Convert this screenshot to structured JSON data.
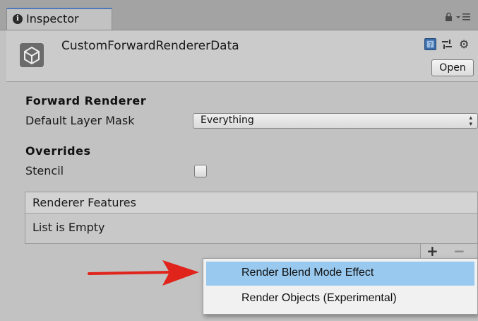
{
  "tab": {
    "title": "Inspector"
  },
  "header": {
    "asset_title": "CustomForwardRendererData",
    "open_label": "Open"
  },
  "forward_renderer": {
    "section_title": "Forward Renderer",
    "layer_mask_label": "Default Layer Mask",
    "layer_mask_value": "Everything"
  },
  "overrides": {
    "section_title": "Overrides",
    "stencil_label": "Stencil",
    "stencil_checked": false
  },
  "renderer_features": {
    "header": "Renderer Features",
    "empty_text": "List is Empty",
    "add_label": "+",
    "remove_label": "−"
  },
  "context_menu": {
    "items": [
      {
        "label": "Render Blend Mode Effect",
        "highlighted": true
      },
      {
        "label": "Render Objects (Experimental)",
        "highlighted": false
      }
    ]
  },
  "colors": {
    "highlight": "#99c9ef",
    "arrow": "#e0231b",
    "tab_accent": "#4d79b8"
  }
}
